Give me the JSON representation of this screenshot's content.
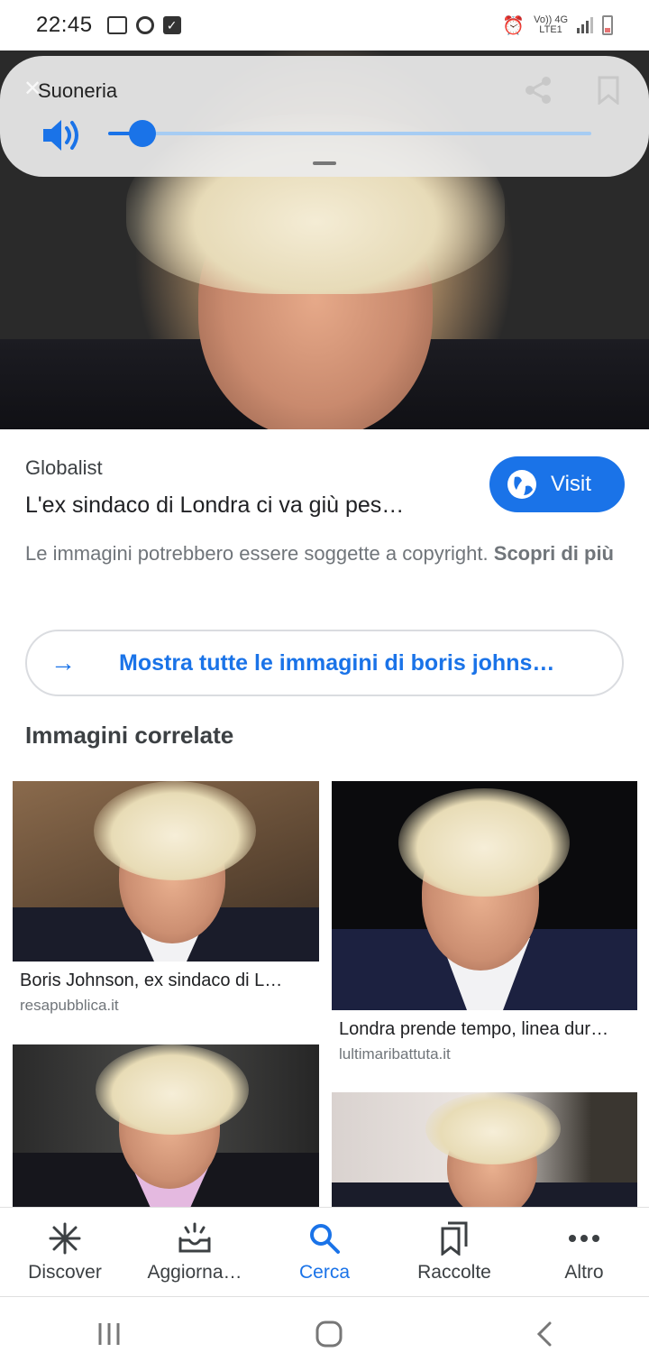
{
  "status_bar": {
    "time": "22:45",
    "network_top": "Vo)) 4G",
    "network_bottom": "LTE1"
  },
  "volume_panel": {
    "title": "Suoneria",
    "level": 0.07
  },
  "result": {
    "source": "Globalist",
    "headline": "L'ex sindaco di Londra ci va giù pes…",
    "visit_label": "Visit",
    "copyright_text": "Le immagini potrebbero essere soggette a copyright.",
    "copyright_link": "Scopri di più"
  },
  "show_all_label": "Mostra tutte le immagini di boris johns…",
  "related_title": "Immagini correlate",
  "related": [
    {
      "caption": "Boris Johnson, ex sindaco di L…",
      "domain": "resapubblica.it"
    },
    {
      "caption": "Londra prende tempo, linea dur…",
      "domain": "lultimaribattuta.it"
    },
    {
      "caption": "",
      "domain": ""
    },
    {
      "caption": "",
      "domain": ""
    }
  ],
  "bottom_nav": [
    {
      "label": "Discover",
      "icon": "asterisk-icon"
    },
    {
      "label": "Aggiorna…",
      "icon": "updates-tray-icon"
    },
    {
      "label": "Cerca",
      "icon": "search-icon",
      "active": true
    },
    {
      "label": "Raccolte",
      "icon": "collections-icon"
    },
    {
      "label": "Altro",
      "icon": "more-dots-icon"
    }
  ],
  "colors": {
    "accent": "#1a73e8",
    "text": "#202124",
    "muted": "#70757a"
  }
}
